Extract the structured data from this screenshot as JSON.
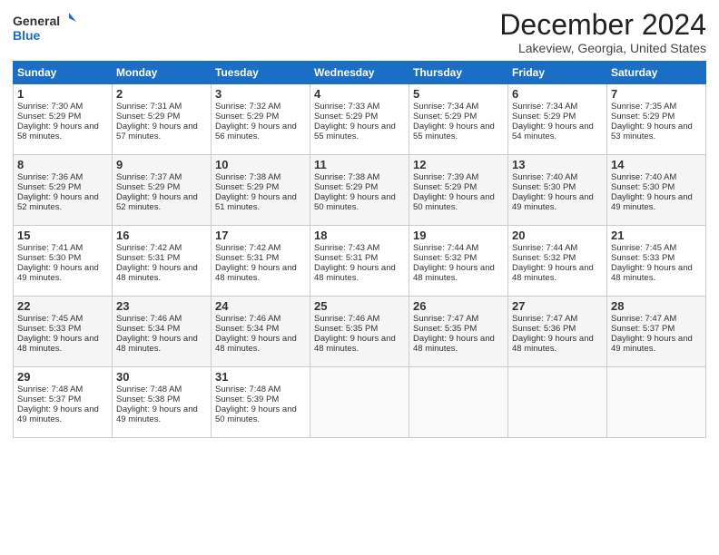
{
  "logo": {
    "line1": "General",
    "line2": "Blue"
  },
  "title": "December 2024",
  "location": "Lakeview, Georgia, United States",
  "days_of_week": [
    "Sunday",
    "Monday",
    "Tuesday",
    "Wednesday",
    "Thursday",
    "Friday",
    "Saturday"
  ],
  "weeks": [
    [
      {
        "day": "1",
        "sunrise": "Sunrise: 7:30 AM",
        "sunset": "Sunset: 5:29 PM",
        "daylight": "Daylight: 9 hours and 58 minutes."
      },
      {
        "day": "2",
        "sunrise": "Sunrise: 7:31 AM",
        "sunset": "Sunset: 5:29 PM",
        "daylight": "Daylight: 9 hours and 57 minutes."
      },
      {
        "day": "3",
        "sunrise": "Sunrise: 7:32 AM",
        "sunset": "Sunset: 5:29 PM",
        "daylight": "Daylight: 9 hours and 56 minutes."
      },
      {
        "day": "4",
        "sunrise": "Sunrise: 7:33 AM",
        "sunset": "Sunset: 5:29 PM",
        "daylight": "Daylight: 9 hours and 55 minutes."
      },
      {
        "day": "5",
        "sunrise": "Sunrise: 7:34 AM",
        "sunset": "Sunset: 5:29 PM",
        "daylight": "Daylight: 9 hours and 55 minutes."
      },
      {
        "day": "6",
        "sunrise": "Sunrise: 7:34 AM",
        "sunset": "Sunset: 5:29 PM",
        "daylight": "Daylight: 9 hours and 54 minutes."
      },
      {
        "day": "7",
        "sunrise": "Sunrise: 7:35 AM",
        "sunset": "Sunset: 5:29 PM",
        "daylight": "Daylight: 9 hours and 53 minutes."
      }
    ],
    [
      {
        "day": "8",
        "sunrise": "Sunrise: 7:36 AM",
        "sunset": "Sunset: 5:29 PM",
        "daylight": "Daylight: 9 hours and 52 minutes."
      },
      {
        "day": "9",
        "sunrise": "Sunrise: 7:37 AM",
        "sunset": "Sunset: 5:29 PM",
        "daylight": "Daylight: 9 hours and 52 minutes."
      },
      {
        "day": "10",
        "sunrise": "Sunrise: 7:38 AM",
        "sunset": "Sunset: 5:29 PM",
        "daylight": "Daylight: 9 hours and 51 minutes."
      },
      {
        "day": "11",
        "sunrise": "Sunrise: 7:38 AM",
        "sunset": "Sunset: 5:29 PM",
        "daylight": "Daylight: 9 hours and 50 minutes."
      },
      {
        "day": "12",
        "sunrise": "Sunrise: 7:39 AM",
        "sunset": "Sunset: 5:29 PM",
        "daylight": "Daylight: 9 hours and 50 minutes."
      },
      {
        "day": "13",
        "sunrise": "Sunrise: 7:40 AM",
        "sunset": "Sunset: 5:30 PM",
        "daylight": "Daylight: 9 hours and 49 minutes."
      },
      {
        "day": "14",
        "sunrise": "Sunrise: 7:40 AM",
        "sunset": "Sunset: 5:30 PM",
        "daylight": "Daylight: 9 hours and 49 minutes."
      }
    ],
    [
      {
        "day": "15",
        "sunrise": "Sunrise: 7:41 AM",
        "sunset": "Sunset: 5:30 PM",
        "daylight": "Daylight: 9 hours and 49 minutes."
      },
      {
        "day": "16",
        "sunrise": "Sunrise: 7:42 AM",
        "sunset": "Sunset: 5:31 PM",
        "daylight": "Daylight: 9 hours and 48 minutes."
      },
      {
        "day": "17",
        "sunrise": "Sunrise: 7:42 AM",
        "sunset": "Sunset: 5:31 PM",
        "daylight": "Daylight: 9 hours and 48 minutes."
      },
      {
        "day": "18",
        "sunrise": "Sunrise: 7:43 AM",
        "sunset": "Sunset: 5:31 PM",
        "daylight": "Daylight: 9 hours and 48 minutes."
      },
      {
        "day": "19",
        "sunrise": "Sunrise: 7:44 AM",
        "sunset": "Sunset: 5:32 PM",
        "daylight": "Daylight: 9 hours and 48 minutes."
      },
      {
        "day": "20",
        "sunrise": "Sunrise: 7:44 AM",
        "sunset": "Sunset: 5:32 PM",
        "daylight": "Daylight: 9 hours and 48 minutes."
      },
      {
        "day": "21",
        "sunrise": "Sunrise: 7:45 AM",
        "sunset": "Sunset: 5:33 PM",
        "daylight": "Daylight: 9 hours and 48 minutes."
      }
    ],
    [
      {
        "day": "22",
        "sunrise": "Sunrise: 7:45 AM",
        "sunset": "Sunset: 5:33 PM",
        "daylight": "Daylight: 9 hours and 48 minutes."
      },
      {
        "day": "23",
        "sunrise": "Sunrise: 7:46 AM",
        "sunset": "Sunset: 5:34 PM",
        "daylight": "Daylight: 9 hours and 48 minutes."
      },
      {
        "day": "24",
        "sunrise": "Sunrise: 7:46 AM",
        "sunset": "Sunset: 5:34 PM",
        "daylight": "Daylight: 9 hours and 48 minutes."
      },
      {
        "day": "25",
        "sunrise": "Sunrise: 7:46 AM",
        "sunset": "Sunset: 5:35 PM",
        "daylight": "Daylight: 9 hours and 48 minutes."
      },
      {
        "day": "26",
        "sunrise": "Sunrise: 7:47 AM",
        "sunset": "Sunset: 5:35 PM",
        "daylight": "Daylight: 9 hours and 48 minutes."
      },
      {
        "day": "27",
        "sunrise": "Sunrise: 7:47 AM",
        "sunset": "Sunset: 5:36 PM",
        "daylight": "Daylight: 9 hours and 48 minutes."
      },
      {
        "day": "28",
        "sunrise": "Sunrise: 7:47 AM",
        "sunset": "Sunset: 5:37 PM",
        "daylight": "Daylight: 9 hours and 49 minutes."
      }
    ],
    [
      {
        "day": "29",
        "sunrise": "Sunrise: 7:48 AM",
        "sunset": "Sunset: 5:37 PM",
        "daylight": "Daylight: 9 hours and 49 minutes."
      },
      {
        "day": "30",
        "sunrise": "Sunrise: 7:48 AM",
        "sunset": "Sunset: 5:38 PM",
        "daylight": "Daylight: 9 hours and 49 minutes."
      },
      {
        "day": "31",
        "sunrise": "Sunrise: 7:48 AM",
        "sunset": "Sunset: 5:39 PM",
        "daylight": "Daylight: 9 hours and 50 minutes."
      },
      null,
      null,
      null,
      null
    ]
  ]
}
